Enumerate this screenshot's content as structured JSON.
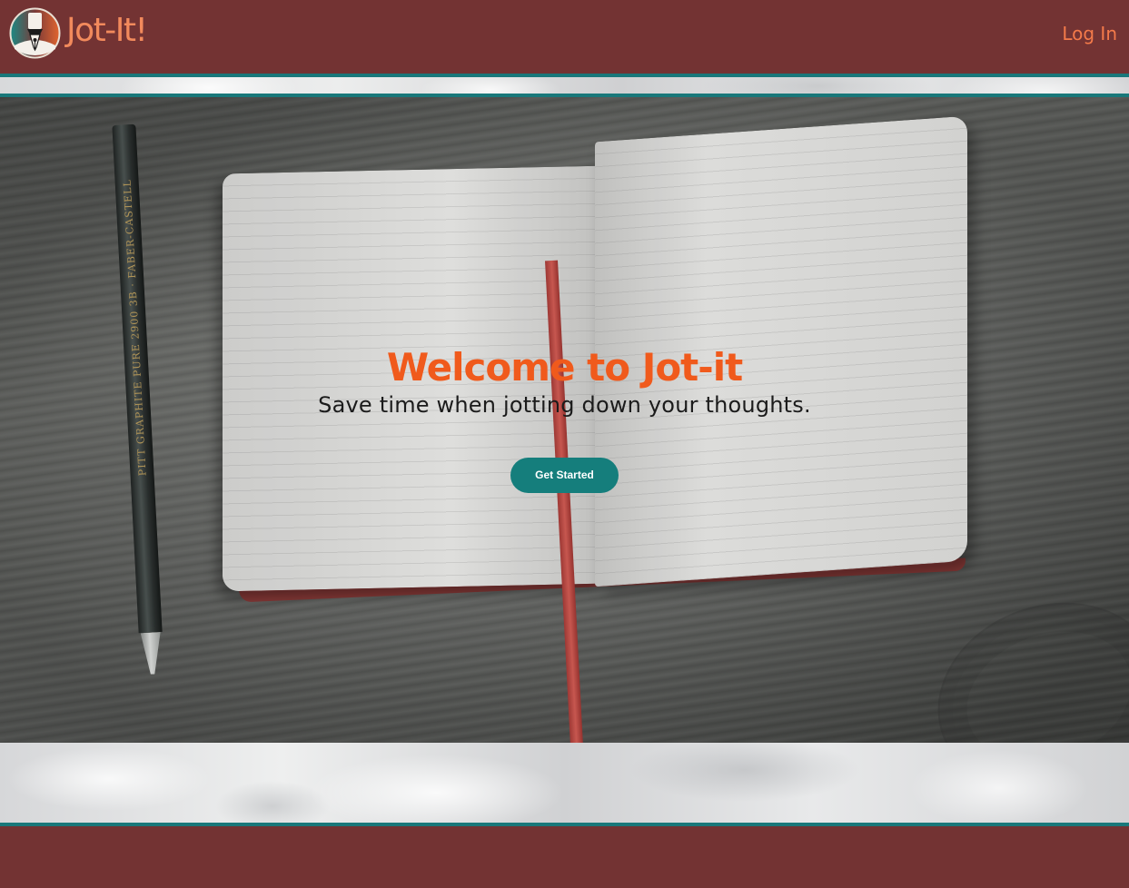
{
  "header": {
    "logo_text": "Jot-It!",
    "login_label": "Log In"
  },
  "hero": {
    "title": "Welcome to Jot-it",
    "subtitle": "Save time when jotting down your thoughts.",
    "cta_label": "Get Started",
    "pencil_text": "PITT GRAPHITE PURE 2900 3B · FABER-CASTELL"
  },
  "colors": {
    "header_bg": "#733333",
    "accent_orange": "#f05a1c",
    "teal": "#157e7c",
    "logo_text": "#f28a5c"
  },
  "icons": {
    "logo": "fountain-pen-nib-badge-icon"
  }
}
